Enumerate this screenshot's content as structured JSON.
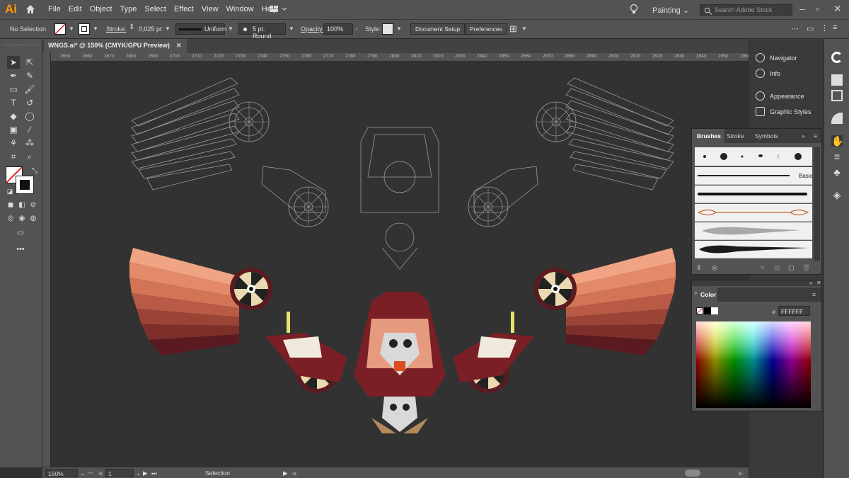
{
  "app": {
    "logo": "Ai",
    "brand_color": "#ff9a00"
  },
  "menu": [
    "File",
    "Edit",
    "Object",
    "Type",
    "Select",
    "Effect",
    "View",
    "Window",
    "Help"
  ],
  "workspace": "Painting",
  "search": {
    "placeholder": "Search Adobe Stock"
  },
  "control": {
    "selection": "No Selection",
    "stroke_label": "Stroke:",
    "stroke_value": "0,025 pt",
    "profile": "Uniform",
    "brush": "5 pt. Round",
    "opacity_label": "Opacity:",
    "opacity_value": "100%",
    "style_label": "Style:",
    "doc_setup": "Document Setup",
    "preferences": "Preferences"
  },
  "document": {
    "tab_title": "WNGS.ai* @ 150% (CMYK/GPU Preview)"
  },
  "ruler": {
    "ticks": [
      "2650",
      "2660",
      "2670",
      "2680",
      "2690",
      "2700",
      "2710",
      "2720",
      "2730",
      "2740",
      "2750",
      "2760",
      "2770",
      "2780",
      "2790",
      "2800",
      "2810",
      "2820",
      "2830",
      "2840",
      "2850",
      "2860",
      "2870",
      "2880",
      "2890",
      "2900",
      "2910",
      "2920",
      "2930",
      "2940",
      "2950",
      "2960"
    ]
  },
  "status": {
    "zoom": "150%",
    "artboard": "1",
    "tool": "Selection"
  },
  "dock": {
    "items": [
      {
        "label": "Navigator",
        "icon": "navigator-icon"
      },
      {
        "label": "Info",
        "icon": "info-icon"
      },
      {
        "label": "Appearance",
        "icon": "appearance-icon"
      },
      {
        "label": "Graphic Styles",
        "icon": "graphic-styles-icon"
      }
    ]
  },
  "brushes_panel": {
    "tabs": [
      "Brushes",
      "Stroke",
      "Symbols"
    ],
    "basic_label": "Basic"
  },
  "color_panel": {
    "title": "Color",
    "hash": "#",
    "hex": "FFFFFF"
  },
  "colors": {
    "chrome": "#535353",
    "canvas": "#323232",
    "wing_dark": "#5b1a1f",
    "wing_light": "#e48a6a",
    "skin": "#e69a7e",
    "maroon": "#7a1f25"
  }
}
